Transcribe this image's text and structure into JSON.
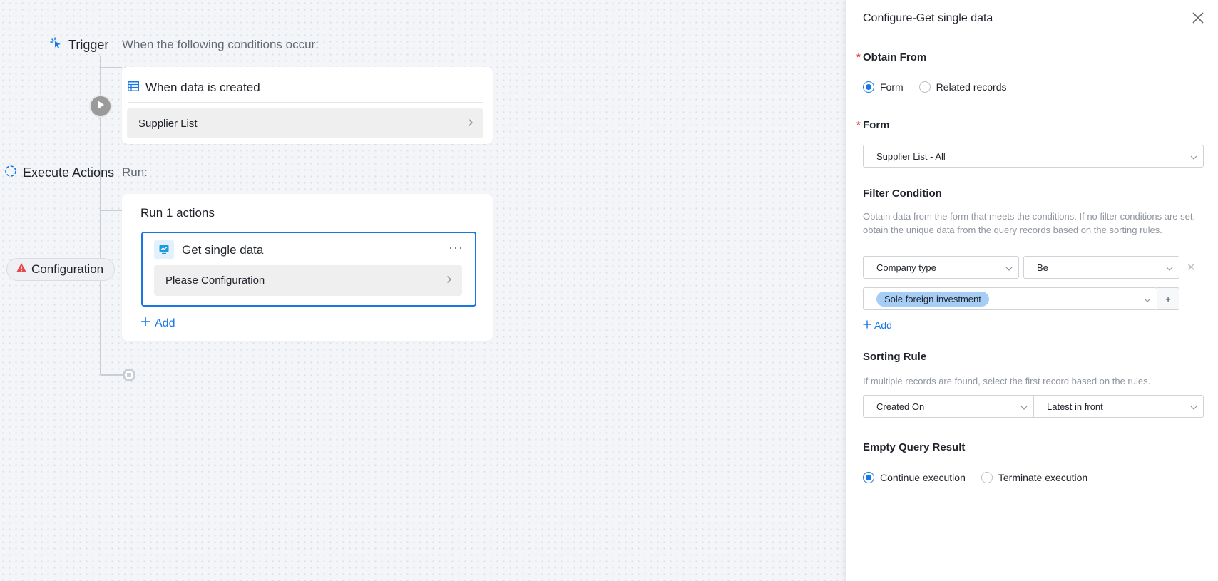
{
  "flow": {
    "trigger": {
      "label": "Trigger",
      "subtitle": "When the following conditions occur:",
      "event_label": "When data is created",
      "source_label": "Supplier List"
    },
    "execute": {
      "label": "Execute Actions",
      "subtitle": "Run:",
      "run_title": "Run 1 actions",
      "action_name": "Get single data",
      "action_more": "···",
      "action_config_prompt": "Please Configuration",
      "add_label": "Add"
    },
    "config_pill_label": "Configuration"
  },
  "panel": {
    "title": "Configure-Get single data",
    "obtain_from": {
      "title": "Obtain From",
      "required_mark": "*",
      "options": [
        "Form",
        "Related records"
      ],
      "selected": "Form"
    },
    "form": {
      "title": "Form",
      "required_mark": "*",
      "value": "Supplier List - All"
    },
    "filter": {
      "title": "Filter Condition",
      "description": "Obtain data from the form that meets the conditions. If no filter conditions are set, obtain the unique data from the query records based on the sorting rules.",
      "field": "Company type",
      "operator": "Be",
      "value_tag": "Sole foreign investment",
      "plus_label": "+",
      "remove_label": "✕",
      "add_label": "Add"
    },
    "sorting": {
      "title": "Sorting Rule",
      "description": "If multiple records are found, select the first record based on the rules.",
      "field": "Created On",
      "order": "Latest in front"
    },
    "empty_result": {
      "title": "Empty Query Result",
      "options": [
        "Continue execution",
        "Terminate execution"
      ],
      "selected": "Continue execution"
    }
  },
  "colors": {
    "accent": "#1677e5",
    "required": "#e02020",
    "warning": "#e5484d"
  }
}
